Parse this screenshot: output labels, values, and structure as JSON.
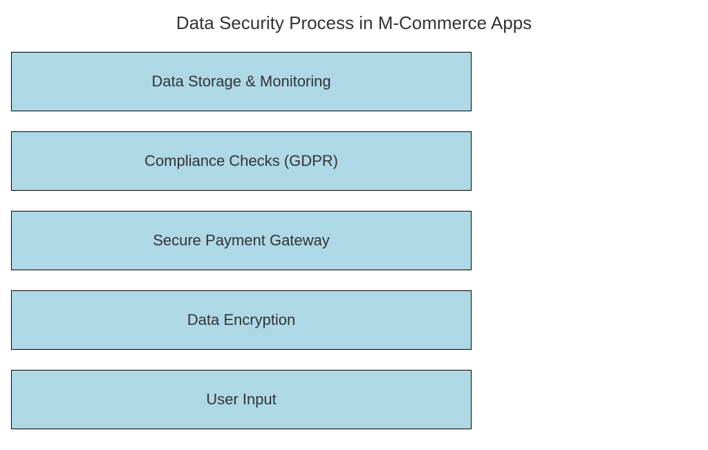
{
  "title": "Data Security Process in M-Commerce Apps",
  "boxes": [
    {
      "label": "Data Storage & Monitoring"
    },
    {
      "label": "Compliance Checks (GDPR)"
    },
    {
      "label": "Secure Payment Gateway"
    },
    {
      "label": "Data Encryption"
    },
    {
      "label": "User Input"
    }
  ],
  "colors": {
    "box_fill": "#aed8e6",
    "box_border": "#000000",
    "text": "#333333",
    "background": "#ffffff"
  }
}
